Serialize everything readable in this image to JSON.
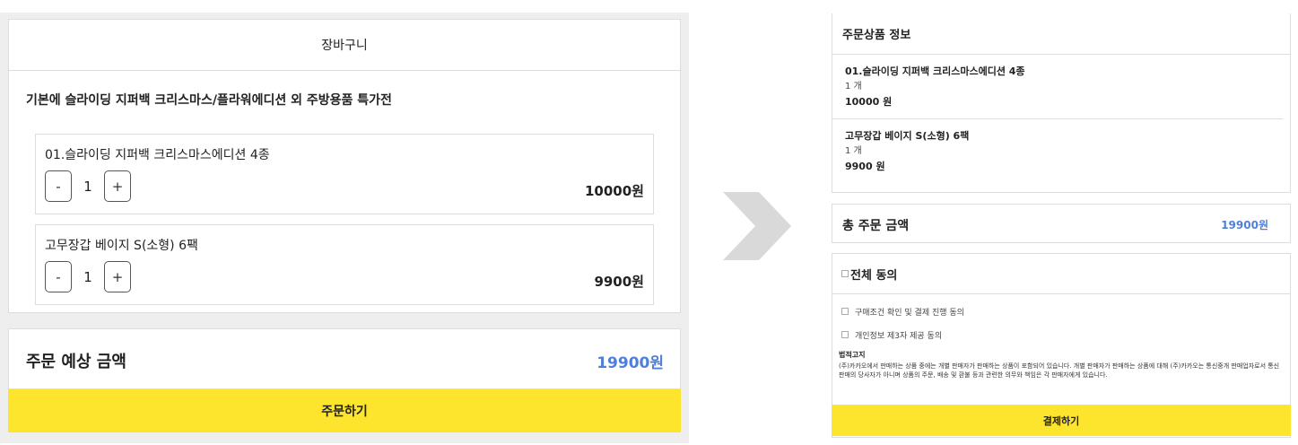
{
  "cart": {
    "title": "장바구니",
    "subtitle": "기본에 슬라이딩 지퍼백 크리스마스/플라워에디션 외 주방용품 특가전",
    "items": [
      {
        "name": "01.슬라이딩 지퍼백 크리스마스에디션 4종",
        "minus": "-",
        "qty": "1",
        "plus": "+",
        "price": "10000원"
      },
      {
        "name": "고무장갑 베이지 S(소형) 6팩",
        "minus": "-",
        "qty": "1",
        "plus": "+",
        "price": "9900원"
      }
    ],
    "summary_label": "주문 예상 금액",
    "summary_value": "19900원",
    "order_button": "주문하기"
  },
  "checkout": {
    "order_info_title": "주문상품 정보",
    "items": [
      {
        "name": "01.슬라이딩 지퍼백 크리스마스에디션 4종",
        "qty": "1 개",
        "price": "10000 원"
      },
      {
        "name": "고무장갑 베이지 S(소형) 6팩",
        "qty": "1 개",
        "price": "9900 원"
      }
    ],
    "total_label": "총 주문 금액",
    "total_value": "19900원",
    "agree_all": "전체 동의",
    "agree_items": [
      "구매조건 확인 및 결제 진행 동의",
      "개인정보 제3자 제공 동의"
    ],
    "legal_title": "법적고지",
    "legal_text": "(주)카카오에서 판매하는 상품 중에는 개별 판매자가 판매하는 상품이 포함되어 있습니다. 개별 판매자가 판매하는 상품에 대해 (주)카카오는 통신중개 판매업자로서 통신판매의 당사자가 아니며 상품의 주문, 배송 및 환불 등과 관련한 의무와 책임은 각 판매자에게 있습니다.",
    "pay_button": "결제하기"
  },
  "colors": {
    "accent_yellow": "#fde52e",
    "price_blue": "#4f7fd8",
    "arrow_gray": "#d9d9d9"
  }
}
